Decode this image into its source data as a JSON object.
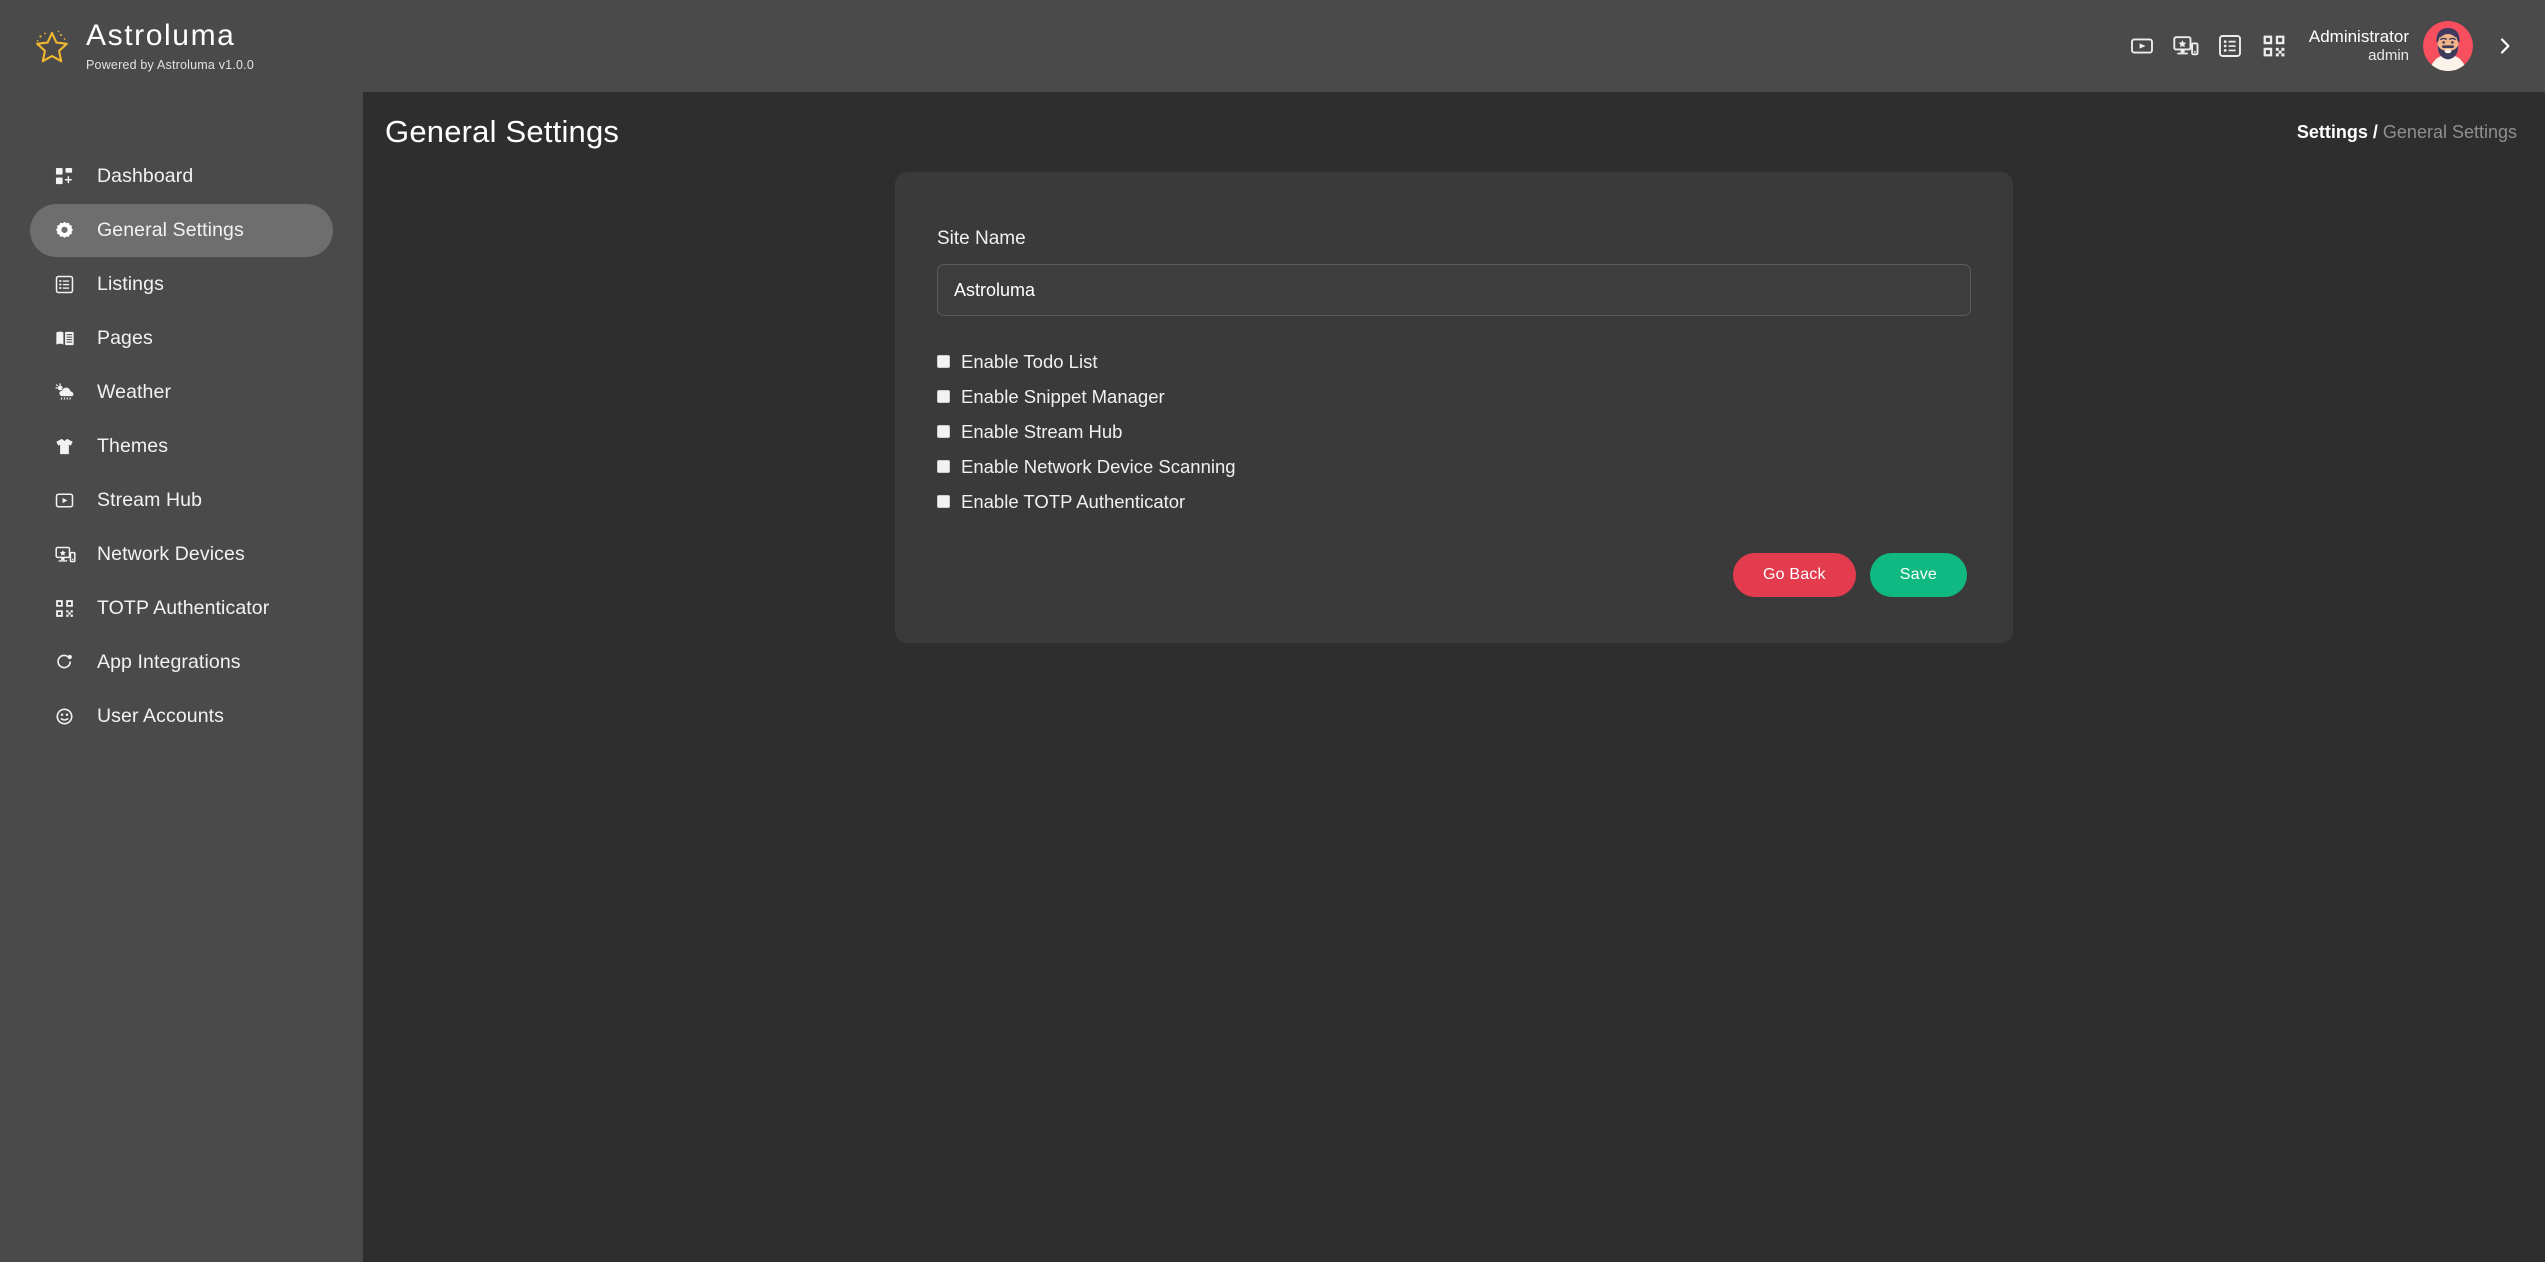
{
  "brand": {
    "name": "Astroluma",
    "tagline": "Powered by Astroluma v1.0.0",
    "logo_icon": "star-icon",
    "logo_color": "#f2b830"
  },
  "sidebar": {
    "items": [
      {
        "label": "Dashboard",
        "icon": "grid-plus-icon",
        "active": false
      },
      {
        "label": "General Settings",
        "icon": "gear-icon",
        "active": true
      },
      {
        "label": "Listings",
        "icon": "list-box-icon",
        "active": false
      },
      {
        "label": "Pages",
        "icon": "open-book-icon",
        "active": false
      },
      {
        "label": "Weather",
        "icon": "cloud-rain-sun-icon",
        "active": false
      },
      {
        "label": "Themes",
        "icon": "tshirt-icon",
        "active": false
      },
      {
        "label": "Stream Hub",
        "icon": "play-box-icon",
        "active": false
      },
      {
        "label": "Network Devices",
        "icon": "monitor-phone-icon",
        "active": false
      },
      {
        "label": "TOTP Authenticator",
        "icon": "qr-code-icon",
        "active": false
      },
      {
        "label": "App Integrations",
        "icon": "refresh-dot-icon",
        "active": false
      },
      {
        "label": "User Accounts",
        "icon": "face-icon",
        "active": false
      }
    ]
  },
  "topbar": {
    "icons": [
      {
        "name": "play-box-icon"
      },
      {
        "name": "monitor-phone-star-icon"
      },
      {
        "name": "list-box-icon"
      },
      {
        "name": "qr-code-icon"
      }
    ],
    "user": {
      "name": "Administrator",
      "role": "admin",
      "avatar_alt": "bearded-man-avatar",
      "avatar_bg": "#f74f5e"
    },
    "expand_icon": "chevron-right-icon"
  },
  "page": {
    "title": "General Settings",
    "breadcrumb": {
      "parent": "Settings /",
      "current": "General Settings"
    }
  },
  "form": {
    "site_name": {
      "label": "Site Name",
      "value": "Astroluma",
      "placeholder": "Site Name"
    },
    "checkboxes": [
      {
        "label": "Enable Todo List",
        "checked": false
      },
      {
        "label": "Enable Snippet Manager",
        "checked": false
      },
      {
        "label": "Enable Stream Hub",
        "checked": false
      },
      {
        "label": "Enable Network Device Scanning",
        "checked": false
      },
      {
        "label": "Enable TOTP Authenticator",
        "checked": false
      }
    ],
    "buttons": {
      "back": "Go Back",
      "save": "Save"
    }
  },
  "colors": {
    "sidebar_bg": "#4a4a4a",
    "content_bg": "#2e2e2e",
    "card_bg": "#3a3a3a",
    "active_item": "#6e6e6e",
    "danger": "#e23c4e",
    "success": "#10b981",
    "accent": "#f2b830"
  }
}
